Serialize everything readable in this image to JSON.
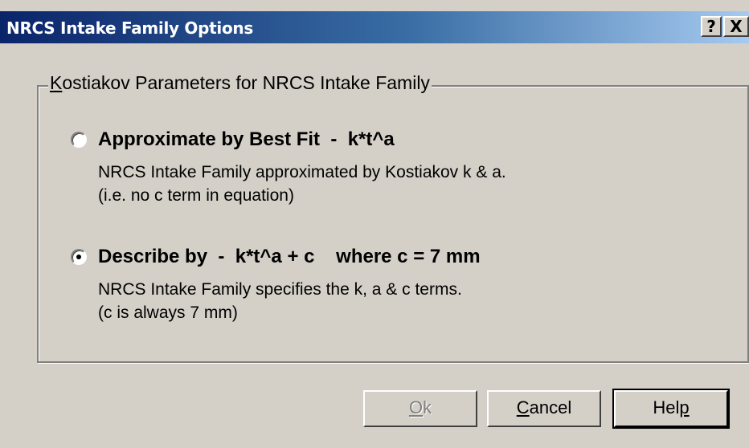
{
  "window": {
    "title": "NRCS Intake Family Options",
    "help_button": "?",
    "close_button": "X"
  },
  "group": {
    "legend_mnemonic": "K",
    "legend_rest": "ostiakov Parameters for NRCS Intake Family"
  },
  "options": [
    {
      "label": "Approximate by Best Fit  -  k*t^a",
      "selected": false,
      "desc_line1": "NRCS Intake Family approximated by Kostiakov k & a.",
      "desc_line2": "(i.e. no c term in equation)"
    },
    {
      "label": "Describe by  -  k*t^a + c    where c = 7 mm",
      "selected": true,
      "desc_line1": "NRCS Intake Family specifies the k, a & c terms.",
      "desc_line2": "(c is always 7 mm)"
    }
  ],
  "buttons": {
    "ok_mnemonic": "O",
    "ok_rest": "k",
    "ok_enabled": false,
    "cancel_mnemonic": "C",
    "cancel_rest": "ancel",
    "help_pre": "Hel",
    "help_mnemonic": "p"
  }
}
